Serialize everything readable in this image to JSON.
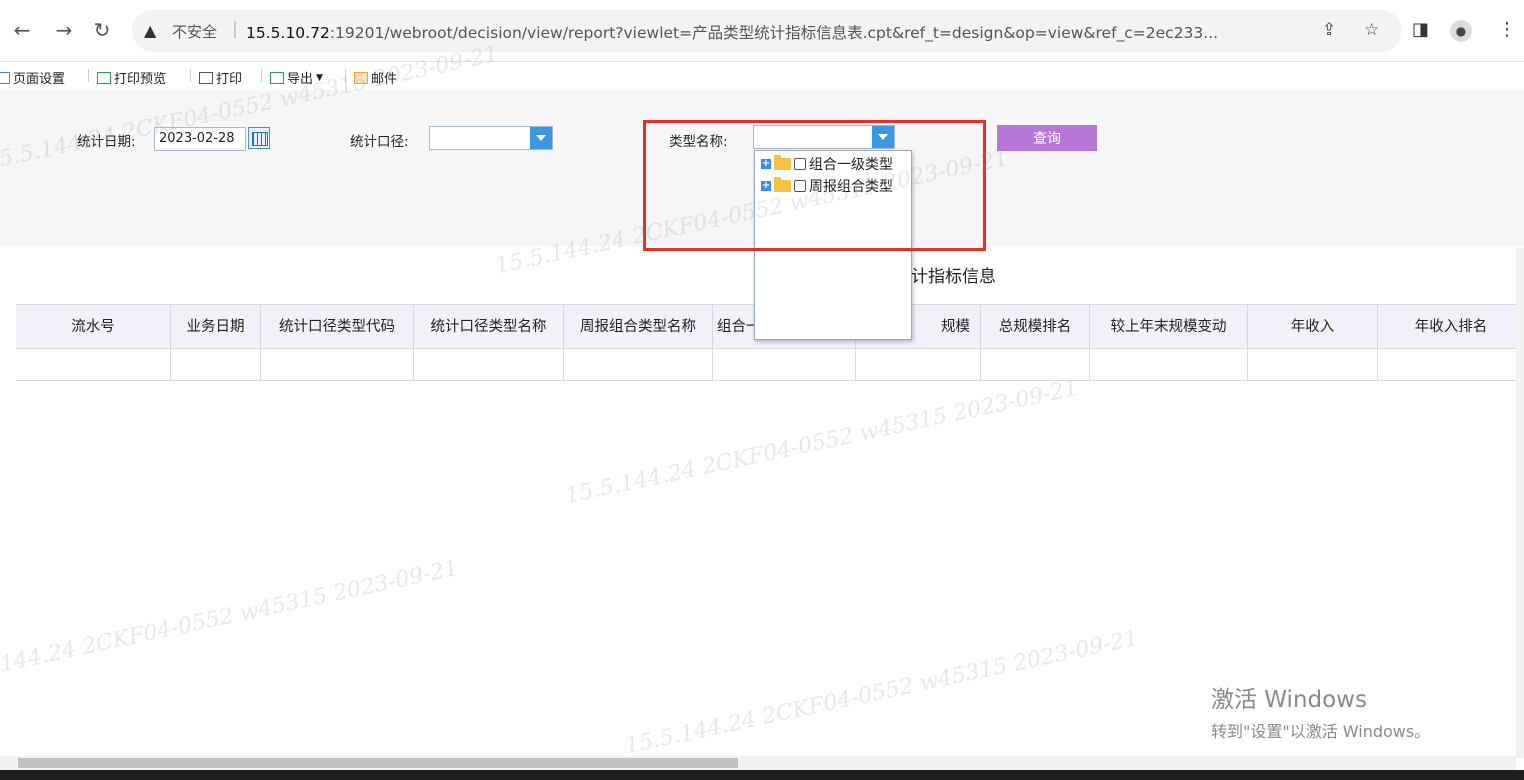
{
  "browser": {
    "security_label": "不安全",
    "url_host": "15.5.10.72",
    "url_rest": ":19201/webroot/decision/view/report?viewlet=产品类型统计指标信息表.cpt&ref_t=design&op=view&ref_c=2ec233..."
  },
  "report_toolbar": {
    "page_setup": "页面设置",
    "print_preview": "打印预览",
    "print": "打印",
    "export": "导出",
    "mail": "邮件"
  },
  "params": {
    "stat_date_label": "统计日期:",
    "stat_date_value": "2023-02-28",
    "stat_scope_label": "统计口径:",
    "stat_scope_value": "",
    "type_name_label": "类型名称:",
    "type_name_value": "",
    "query_button": "查询"
  },
  "dropdown_tree": {
    "nodes": [
      "组合一级类型",
      "周报组合类型"
    ]
  },
  "report": {
    "title_partial": "计指标信息",
    "columns": [
      "流水号",
      "业务日期",
      "统计口径类型代码",
      "统计口径类型名称",
      "周报组合类型名称",
      "组合一",
      "规模",
      "总规模排名",
      "较上年末规模变动",
      "年收入",
      "年收入排名"
    ]
  },
  "os_overlay": {
    "activate_title": "激活 Windows",
    "activate_hint": "转到\"设置\"以激活 Windows。"
  },
  "watermark_text": "15.5.144.24 2CKF04-0552 w45315 2023-09-21"
}
